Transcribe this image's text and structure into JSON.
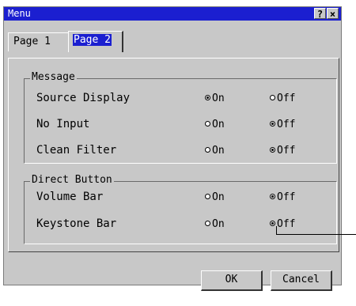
{
  "window": {
    "title": "Menu",
    "help_label": "?",
    "close_label": "×"
  },
  "tabs": [
    {
      "label": "Page 1",
      "active": false
    },
    {
      "label": "Page 2",
      "active": true
    }
  ],
  "groups": {
    "message": {
      "title": "Message",
      "rows": [
        {
          "label": "Source Display",
          "on": "On",
          "off": "Off",
          "selected": "on"
        },
        {
          "label": "No Input",
          "on": "On",
          "off": "Off",
          "selected": "off"
        },
        {
          "label": "Clean Filter",
          "on": "On",
          "off": "Off",
          "selected": "off"
        }
      ]
    },
    "direct_button": {
      "title": "Direct Button",
      "rows": [
        {
          "label": "Volume Bar",
          "on": "On",
          "off": "Off",
          "selected": "off"
        },
        {
          "label": "Keystone Bar",
          "on": "On",
          "off": "Off",
          "selected": "off"
        }
      ]
    }
  },
  "buttons": {
    "ok": "OK",
    "cancel": "Cancel"
  }
}
